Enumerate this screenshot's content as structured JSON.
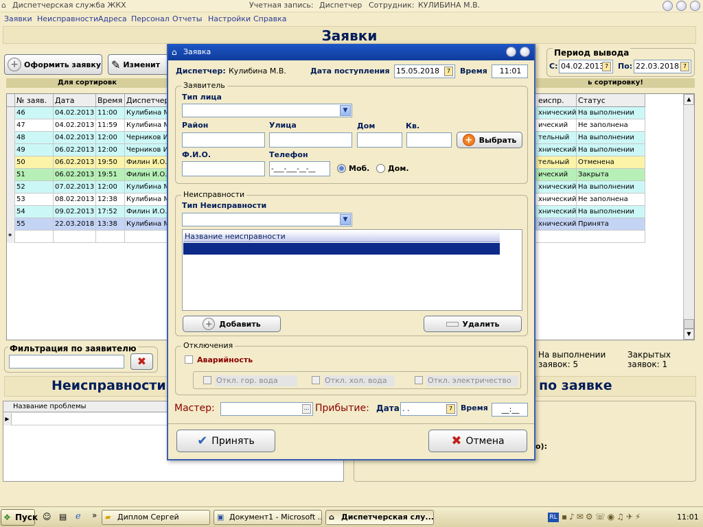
{
  "window": {
    "title": "Диспетчерская служба ЖКХ",
    "account_label": "Учетная запись:",
    "account_value": "Диспетчер",
    "employee_label": "Сотрудник:",
    "employee_value": "КУЛИБИНА М.В."
  },
  "menu": [
    "Заявки",
    "Неисправности",
    "Адреса",
    "Персонал",
    "Отчеты",
    "Настройки",
    "Справка"
  ],
  "main": {
    "title": "Заявки",
    "create_button": "Оформить заявку",
    "edit_button": "Изменит",
    "sort_hint_left": "Для сортировк",
    "sort_hint_right": "ь сортировку!",
    "period_label": "Период вывода",
    "period_from_label": "С:",
    "period_from": "04.02.2013",
    "period_to_label": "По:",
    "period_to": "22.03.2018"
  },
  "grid": {
    "columns": [
      "№ заяв.",
      "Дата",
      "Время",
      "Диспетчер",
      "еиспр.",
      "Статус"
    ],
    "rows": [
      {
        "num": "46",
        "date": "04.02.2013",
        "time": "11:00",
        "disp": "Кулибина М",
        "type": "хнический",
        "status": "На выполнении",
        "color": "#ccf7f7"
      },
      {
        "num": "47",
        "date": "04.02.2013",
        "time": "11:59",
        "disp": "Кулибина М",
        "type": "ический",
        "status": "Не заполнена",
        "color": "#ffffff"
      },
      {
        "num": "48",
        "date": "04.02.2013",
        "time": "12:00",
        "disp": "Черников И",
        "type": "тельный",
        "status": "На выполнении",
        "color": "#ccf7f7"
      },
      {
        "num": "49",
        "date": "06.02.2013",
        "time": "12:00",
        "disp": "Черников И",
        "type": "хнический",
        "status": "На выполнении",
        "color": "#ccf7f7"
      },
      {
        "num": "50",
        "date": "06.02.2013",
        "time": "19:50",
        "disp": "Филин И.О.",
        "type": "тельный",
        "status": "Отменена",
        "color": "#fbf3a8"
      },
      {
        "num": "51",
        "date": "06.02.2013",
        "time": "19:51",
        "disp": "Филин И.О.",
        "type": "ический",
        "status": "Закрыта",
        "color": "#b7f0b7"
      },
      {
        "num": "52",
        "date": "07.02.2013",
        "time": "12:00",
        "disp": "Кулибина М",
        "type": "хнический",
        "status": "На выполнении",
        "color": "#ccf7f7"
      },
      {
        "num": "53",
        "date": "08.02.2013",
        "time": "12:38",
        "disp": "Кулибина М",
        "type": "хнический",
        "status": "Не заполнена",
        "color": "#ffffff"
      },
      {
        "num": "54",
        "date": "09.02.2013",
        "time": "17:52",
        "disp": "Филин И.О.",
        "type": "хнический",
        "status": "На выполнении",
        "color": "#ccf7f7"
      },
      {
        "num": "55",
        "date": "22.03.2018",
        "time": "13:38",
        "disp": "Кулибина М",
        "type": "хнический",
        "status": "Принята",
        "color": "#c4d4f5"
      }
    ],
    "new_row_marker": "*"
  },
  "filter": {
    "label": "Фильтрация по заявителю",
    "value": ""
  },
  "stats": {
    "in_progress": "На выполнении заявок: 5",
    "closed": "Закрытых заявок: 1"
  },
  "bottom": {
    "faults_title": "Неисправности",
    "by_request_title": "по заявке",
    "problem_column": "Название проблемы",
    "right_label": "о):"
  },
  "dialog": {
    "title": "Заявка",
    "dispatcher_label": "Диспетчер:",
    "dispatcher_value": "Кулибина М.В.",
    "received_label": "Дата поступления",
    "received_date": "15.05.2018",
    "time_label": "Время",
    "time_value": "11:01",
    "applicant": {
      "title": "Заявитель",
      "person_type_label": "Тип лица",
      "district_label": "Район",
      "street_label": "Улица",
      "house_label": "Дом",
      "apt_label": "Кв.",
      "select_button": "Выбрать",
      "fio_label": "Ф.И.О.",
      "phone_label": "Телефон",
      "phone_mask": "-___-___-__-__",
      "mobile_label": "Моб.",
      "home_label": "Дом."
    },
    "faults": {
      "title": "Неисправности",
      "type_label": "Тип Неисправности",
      "list_header": "Название неисправности",
      "add_button": "Добавить",
      "delete_button": "Удалить"
    },
    "outages": {
      "title": "Отключения",
      "emergency_label": "Аварийность",
      "hot_water": "Откл. гор. вода",
      "cold_water": "Откл. хол. вода",
      "electricity": "Откл. электричество"
    },
    "master_label": "Мастер:",
    "arrival_label": "Прибытие:",
    "arrival_date_label": "Дата",
    "arrival_date_value": " .  .",
    "arrival_time_label": "Время",
    "arrival_time_value": "__:__",
    "accept_button": "Принять",
    "cancel_button": "Отмена"
  },
  "taskbar": {
    "start": "Пуск",
    "items": [
      "Диплом Сергей",
      "Документ1 - Microsoft ...",
      "Диспетчерская слу..."
    ],
    "lang": "RL",
    "clock": "11:01"
  }
}
